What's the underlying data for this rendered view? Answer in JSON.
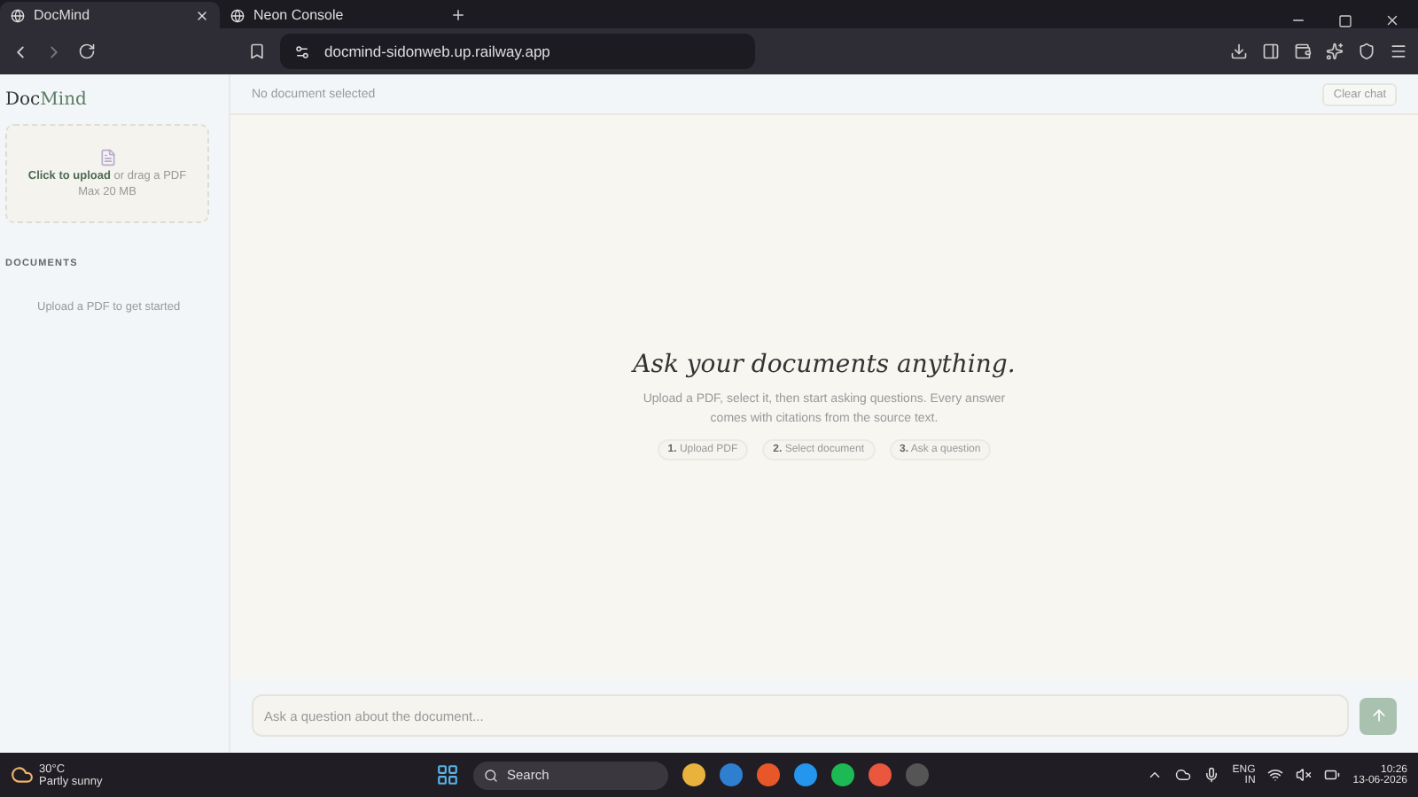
{
  "browser": {
    "tabs": [
      {
        "title": "DocMind",
        "selected": true
      },
      {
        "title": "Neon Console",
        "selected": false
      }
    ],
    "address": "docmind-sidonweb.up.railway.app"
  },
  "sidebar": {
    "brand": {
      "lead": "Doc",
      "accent": "Mind"
    },
    "upload": {
      "text": "**Click to upload** or drag a PDF",
      "limit": "Max 20 MB"
    },
    "documents_heading": "DOCUMENTS",
    "empty_text": "Upload a PDF to get started"
  },
  "header": {
    "status": "No document selected",
    "clear_button": "Clear chat"
  },
  "welcome": {
    "title": "Ask your documents anything.",
    "text": "Upload a PDF, select it, then start asking questions. Every answer comes with citations from the source text.",
    "steps": [
      "**1.** Upload PDF",
      "**2.** Select document",
      "**3.** Ask a question"
    ]
  },
  "composer": {
    "placeholder": "Ask a question about the document..."
  },
  "taskbar": {
    "weather": {
      "temp": "30°C",
      "text": "Partly sunny"
    },
    "search": "Search",
    "lang": "ENG",
    "region": "IN",
    "time": "10:26",
    "date": "13-06-2026"
  }
}
